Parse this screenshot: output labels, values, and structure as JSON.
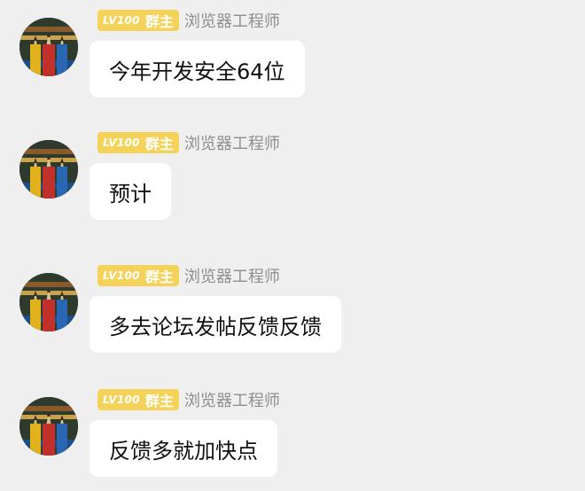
{
  "messages": [
    {
      "level": "LV100",
      "role": "群主",
      "title": "浏览器工程师",
      "text": "今年开发安全64位"
    },
    {
      "level": "LV100",
      "role": "群主",
      "title": "浏览器工程师",
      "text": "预计"
    },
    {
      "level": "LV100",
      "role": "群主",
      "title": "浏览器工程师",
      "text": "多去论坛发帖反馈反馈"
    },
    {
      "level": "LV100",
      "role": "群主",
      "title": "浏览器工程师",
      "text": "反馈多就加快点"
    }
  ],
  "colors": {
    "background": "#efefef",
    "bubble": "#ffffff",
    "badge": "#f5d35a",
    "title": "#8e8e8e"
  }
}
